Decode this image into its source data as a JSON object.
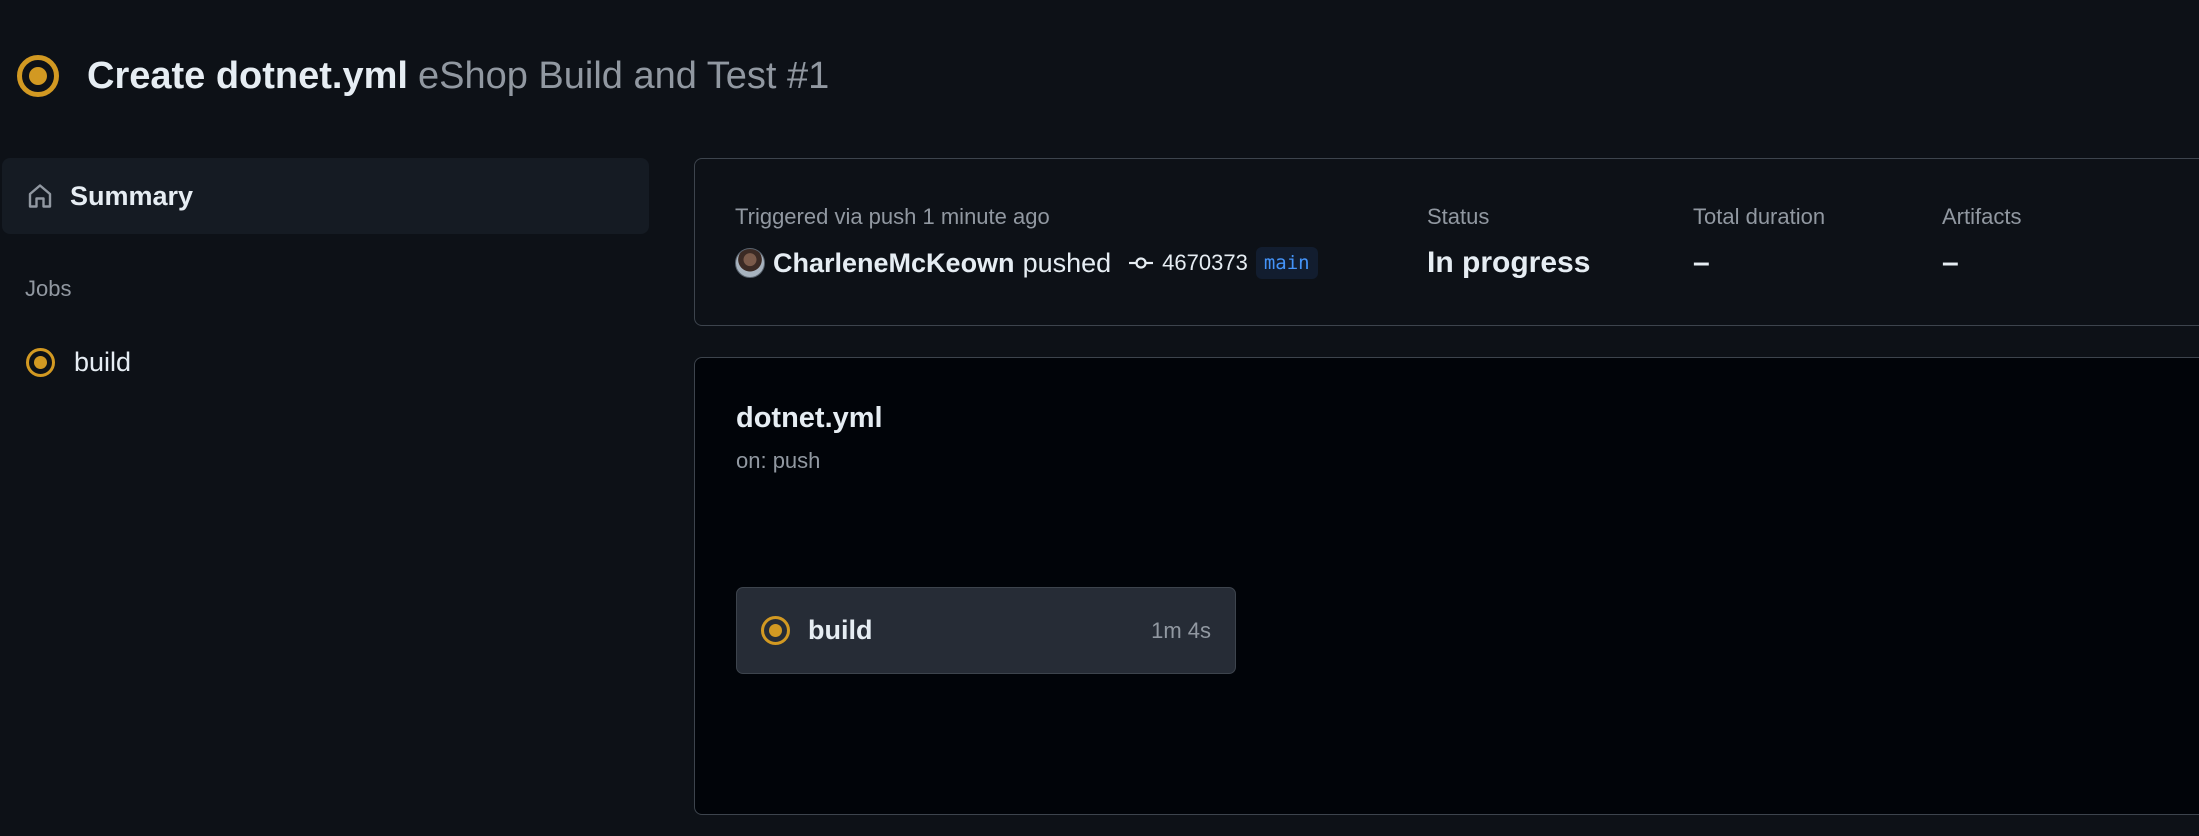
{
  "header": {
    "status_icon": "in-progress-icon",
    "commit_message": "Create dotnet.yml",
    "run_name": "eShop Build and Test #1"
  },
  "sidebar": {
    "summary": {
      "icon": "home-icon",
      "label": "Summary"
    },
    "jobs_heading": "Jobs",
    "jobs": [
      {
        "icon": "in-progress-icon",
        "label": "build"
      }
    ]
  },
  "summary_card": {
    "trigger_text": "Triggered via push 1 minute ago",
    "actor": "CharleneMcKeown",
    "action": "pushed",
    "commit_icon": "git-commit-icon",
    "commit_sha": "4670373",
    "branch": "main",
    "status_label": "Status",
    "status_value": "In progress",
    "duration_label": "Total duration",
    "duration_value": "–",
    "artifacts_label": "Artifacts",
    "artifacts_value": "–"
  },
  "workflow": {
    "file_name": "dotnet.yml",
    "trigger": "on: push",
    "jobs": [
      {
        "icon": "in-progress-icon",
        "name": "build",
        "duration": "1m 4s"
      }
    ]
  },
  "colors": {
    "background": "#0d1117",
    "surface": "#151b23",
    "in_progress": "#d29922",
    "accent_link": "#4493f8",
    "text_primary": "#e6edf3",
    "text_muted": "#9198a1",
    "border": "#3d444d"
  }
}
